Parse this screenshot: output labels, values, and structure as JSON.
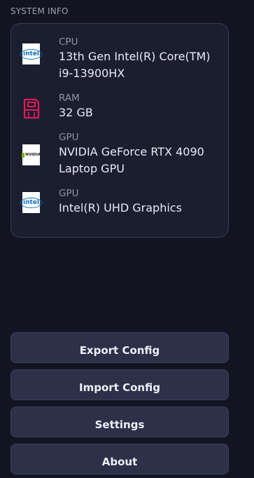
{
  "section": {
    "title": "SYSTEM INFO"
  },
  "hardware": [
    {
      "icon": "intel-icon",
      "label": "CPU",
      "value": "13th Gen Intel(R) Core(TM) i9-13900HX"
    },
    {
      "icon": "ram-icon",
      "label": "RAM",
      "value": "32 GB"
    },
    {
      "icon": "nvidia-icon",
      "label": "GPU",
      "value": "NVIDIA GeForce RTX 4090 Laptop GPU"
    },
    {
      "icon": "intel-icon",
      "label": "GPU",
      "value": "Intel(R) UHD Graphics"
    }
  ],
  "buttons": {
    "export": "Export Config",
    "import": "Import Config",
    "settings": "Settings",
    "about": "About"
  },
  "colors": {
    "background": "#121421",
    "card": "#1b1e2f",
    "button": "#2c3048",
    "ram_icon": "#e5185a",
    "nvidia_green": "#76b900",
    "intel_blue": "#0a6fc2"
  }
}
